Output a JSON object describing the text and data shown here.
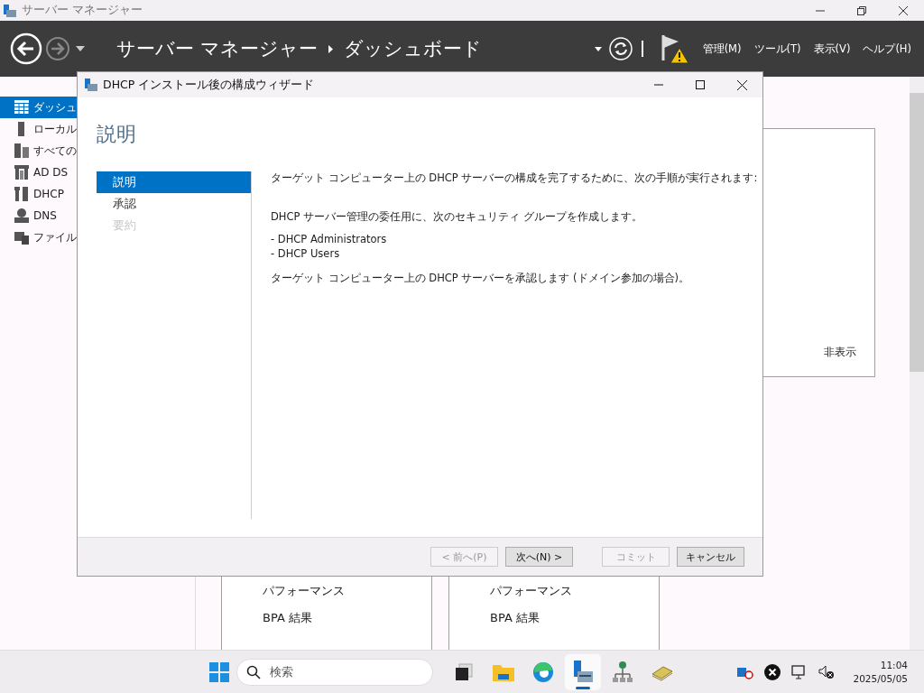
{
  "app_window": {
    "title": "サーバー マネージャー"
  },
  "header": {
    "breadcrumb": [
      "サーバー マネージャー",
      "ダッシュボード"
    ],
    "menus": [
      "管理(M)",
      "ツール(T)",
      "表示(V)",
      "ヘルプ(H)"
    ]
  },
  "sidebar": {
    "items": [
      {
        "label": "ダッシュ",
        "kind": "grid",
        "selected": true
      },
      {
        "label": "ローカル",
        "kind": "server",
        "selected": false
      },
      {
        "label": "すべての",
        "kind": "servers",
        "selected": false
      },
      {
        "label": "AD DS",
        "kind": "adds",
        "selected": false
      },
      {
        "label": "DHCP",
        "kind": "dhcp",
        "selected": false
      },
      {
        "label": "DNS",
        "kind": "dns",
        "selected": false
      },
      {
        "label": "ファイル",
        "kind": "files",
        "selected": false
      }
    ]
  },
  "main": {
    "panel": {
      "action": "非表示"
    },
    "tiles": [
      {
        "items": [
          "パフォーマンス",
          "BPA 結果"
        ]
      },
      {
        "items": [
          "パフォーマンス",
          "BPA 結果"
        ]
      }
    ]
  },
  "dialog": {
    "title": "DHCP インストール後の構成ウィザード",
    "heading": "説明",
    "steps": [
      {
        "label": "説明",
        "selected": true,
        "disabled": false
      },
      {
        "label": "承認",
        "selected": false,
        "disabled": false
      },
      {
        "label": "要約",
        "selected": false,
        "disabled": true
      }
    ],
    "intro": "ターゲット コンピューター上の DHCP サーバーの構成を完了するために、次の手順が実行されます:",
    "groups_text": "DHCP サーバー管理の委任用に、次のセキュリティ グループを作成します。",
    "groups": [
      "- DHCP Administrators",
      "- DHCP Users"
    ],
    "authorize_text": "ターゲット コンピューター上の DHCP サーバーを承認します (ドメイン参加の場合)。",
    "buttons": [
      {
        "label": "< 前へ(P)",
        "disabled": true
      },
      {
        "label": "次へ(N) >",
        "disabled": false
      },
      {
        "label": "コミット",
        "disabled": true
      },
      {
        "label": "キャンセル",
        "disabled": false
      }
    ]
  },
  "taskbar": {
    "search": {
      "placeholder": "検索"
    },
    "apps": [
      {
        "kind": "taskview",
        "active": false
      },
      {
        "kind": "explorer",
        "active": false
      },
      {
        "kind": "edge",
        "active": false
      },
      {
        "kind": "servermanager",
        "active": true
      },
      {
        "kind": "network",
        "active": false
      },
      {
        "kind": "cash",
        "active": false
      }
    ],
    "time": "11:04",
    "date": "2025/05/05"
  }
}
